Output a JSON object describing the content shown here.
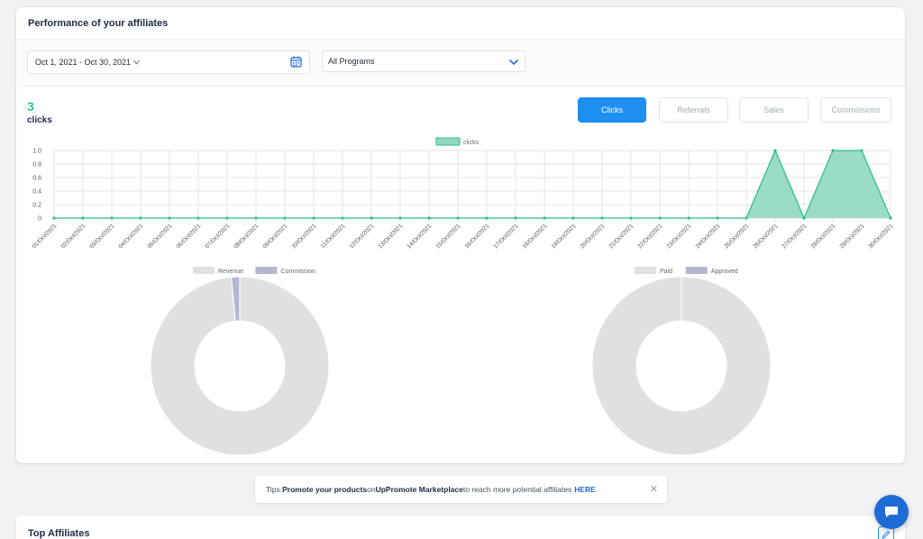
{
  "header": {
    "title": "Performance of your affiliates"
  },
  "filters": {
    "date_range": "Oct 1, 2021 - Oct 30, 2021",
    "program": "All Programs"
  },
  "metric": {
    "value": "3",
    "label": "clicks"
  },
  "tabs": [
    {
      "label": "Clicks",
      "active": true
    },
    {
      "label": "Referrals",
      "active": false
    },
    {
      "label": "Sales",
      "active": false
    },
    {
      "label": "Commissions",
      "active": false
    }
  ],
  "colors": {
    "accent": "#1f8ef1",
    "series": "#2fbf8e",
    "series_fill": "#8fd9be",
    "donut_gray": "#e0e0e0",
    "donut_purple": "#b3b7d0"
  },
  "chart_data": [
    {
      "type": "area",
      "legend": [
        "clicks"
      ],
      "legend_position": "top",
      "grid": true,
      "ylim": [
        0,
        1.0
      ],
      "yticks": [
        "0",
        "0.2",
        "0.4",
        "0.6",
        "0.8",
        "1.0"
      ],
      "categories": [
        "01/Oct/2021",
        "02/Oct/2021",
        "03/Oct/2021",
        "04/Oct/2021",
        "05/Oct/2021",
        "06/Oct/2021",
        "07/Oct/2021",
        "08/Oct/2021",
        "09/Oct/2021",
        "10/Oct/2021",
        "11/Oct/2021",
        "12/Oct/2021",
        "13/Oct/2021",
        "14/Oct/2021",
        "15/Oct/2021",
        "16/Oct/2021",
        "17/Oct/2021",
        "18/Oct/2021",
        "19/Oct/2021",
        "20/Oct/2021",
        "21/Oct/2021",
        "22/Oct/2021",
        "23/Oct/2021",
        "24/Oct/2021",
        "25/Oct/2021",
        "26/Oct/2021",
        "27/Oct/2021",
        "28/Oct/2021",
        "29/Oct/2021",
        "30/Oct/2021"
      ],
      "series": [
        {
          "name": "clicks",
          "values": [
            0,
            0,
            0,
            0,
            0,
            0,
            0,
            0,
            0,
            0,
            0,
            0,
            0,
            0,
            0,
            0,
            0,
            0,
            0,
            0,
            0,
            0,
            0,
            0,
            0,
            1,
            0,
            1,
            1,
            0
          ]
        }
      ]
    },
    {
      "type": "pie",
      "legend": [
        "Revenue",
        "Commission"
      ],
      "legend_position": "top",
      "slices": [
        {
          "name": "Revenue",
          "value": 98.5
        },
        {
          "name": "Commission",
          "value": 1.5
        }
      ]
    },
    {
      "type": "pie",
      "legend": [
        "Paid",
        "Approved"
      ],
      "legend_position": "top",
      "slices": [
        {
          "name": "Paid",
          "value": 100
        },
        {
          "name": "Approved",
          "value": 0
        }
      ]
    }
  ],
  "tips": {
    "prefix": "Tips: ",
    "bold1": "Promote your products",
    "mid": " on ",
    "bold2": "UpPromote Marketplace",
    "suffix": " to reach more potential affiliates",
    "link": "HERE",
    "end": "."
  },
  "top_affiliates": {
    "title": "Top Affiliates"
  },
  "icons": [
    "calendar-icon",
    "chevron-down-icon",
    "close-icon",
    "edit-icon",
    "chat-icon"
  ]
}
